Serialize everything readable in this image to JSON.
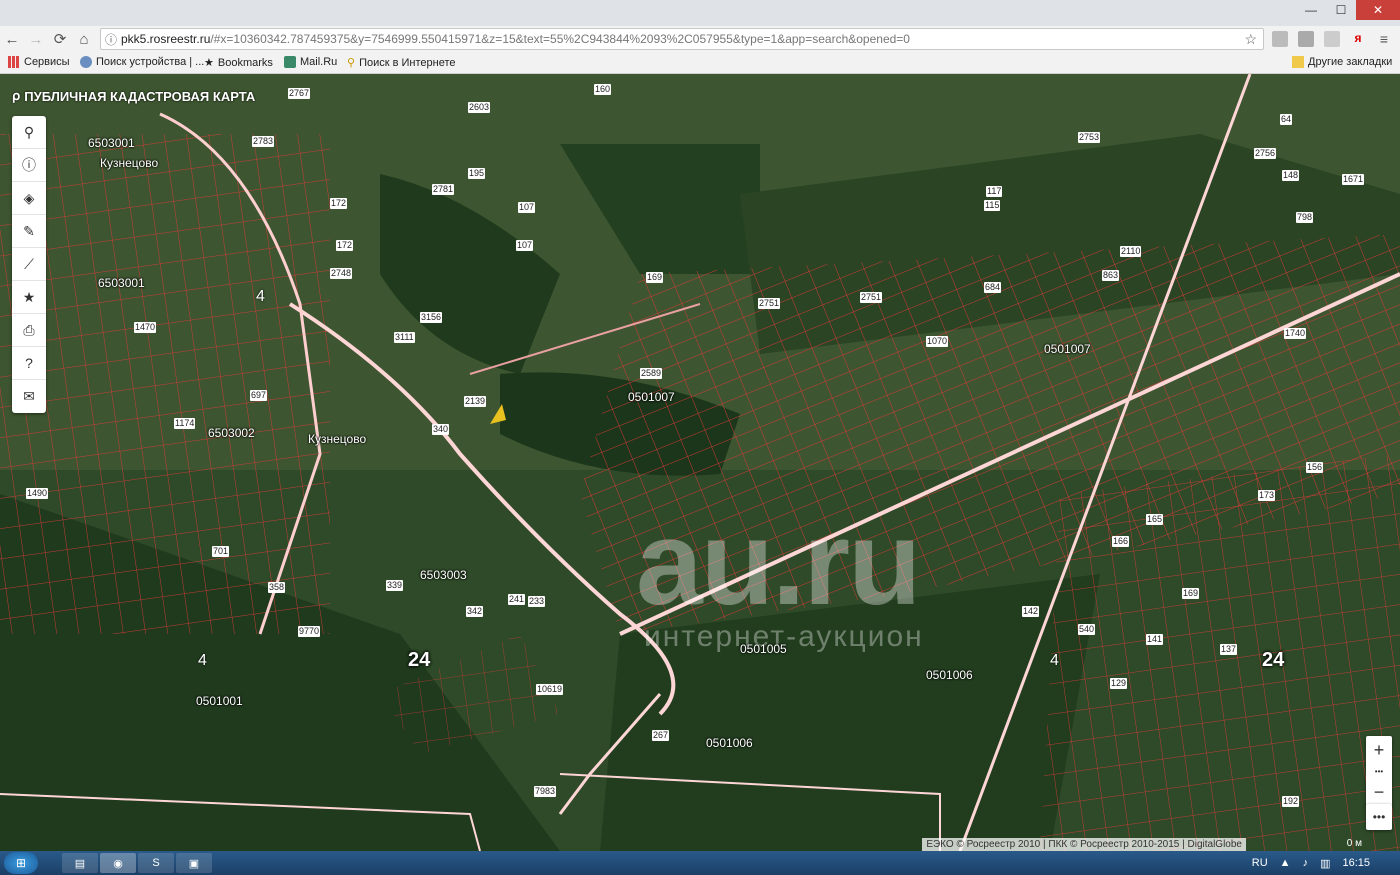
{
  "browser": {
    "url_host": "pkk5.rosreestr.ru",
    "url_path": "/#x=10360342.787459375&y=7546999.550415971&z=15&text=55%2C943844%2093%2C057955&type=1&app=search&opened=0",
    "window_controls": [
      "—",
      "☐",
      "✕"
    ]
  },
  "bookmarks": {
    "apps": "Сервисы",
    "device_search": "Поиск устройства | ...",
    "bookmarks": "Bookmarks",
    "mailru": "Mail.Ru",
    "internet_search": "Поиск в Интернете",
    "other": "Другие закладки"
  },
  "map": {
    "title": "ПУБЛИЧНАЯ КАДАСТРОВАЯ КАРТА",
    "tools": [
      "search-icon",
      "info-icon",
      "layers-icon",
      "pencil-icon",
      "measure-icon",
      "star-icon",
      "print-icon",
      "help-icon",
      "mail-icon"
    ],
    "zoom_in": "+",
    "zoom_out": "−",
    "more": "•••",
    "copyright": "ЕЭКО © Росреестр 2010 | ПКК © Росреестр 2010-2015 | DigitalGlobe",
    "scale": "0 м",
    "watermark_big": "au.ru",
    "watermark_small": "интернет-аукцион",
    "places": [
      "Кузнецово",
      "Кузнецово"
    ],
    "roads": [
      "24",
      "24"
    ],
    "fours": [
      "4",
      "4",
      "4"
    ],
    "quarters": [
      "6503001",
      "6503001",
      "6503002",
      "6503003",
      "0501007",
      "0501007",
      "0501005",
      "0501006",
      "0501006",
      "0501001"
    ],
    "parcels": [
      "2767",
      "2603",
      "160",
      "2783",
      "172",
      "195",
      "107",
      "107",
      "2781",
      "172",
      "2748",
      "3156",
      "3111",
      "2139",
      "169",
      "2751",
      "2751",
      "2589",
      "340",
      "684",
      "1070",
      "64",
      "2756",
      "148",
      "1671",
      "798",
      "2110",
      "863",
      "1740",
      "156",
      "173",
      "165",
      "166",
      "169",
      "142",
      "540",
      "141",
      "137",
      "129",
      "192",
      "1174",
      "701",
      "697",
      "358",
      "339",
      "342",
      "241",
      "233",
      "10619",
      "267",
      "7983",
      "9770",
      "1490",
      "1470",
      "117",
      "115",
      "2753"
    ]
  },
  "taskbar": {
    "lang": "RU",
    "time": "16:15"
  }
}
